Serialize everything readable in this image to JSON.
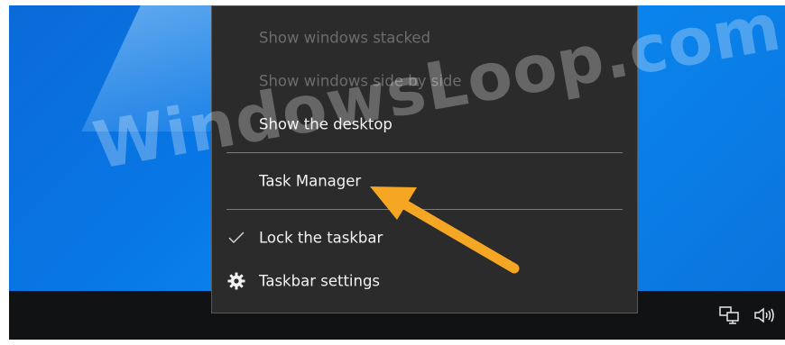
{
  "menu": {
    "items": [
      {
        "label": "Show windows stacked",
        "enabled": false
      },
      {
        "label": "Show windows side by side",
        "enabled": false
      },
      {
        "label": "Show the desktop",
        "enabled": true
      },
      {
        "label": "Task Manager",
        "enabled": true
      },
      {
        "label": "Lock the taskbar",
        "enabled": true,
        "checked": true
      },
      {
        "label": "Taskbar settings",
        "enabled": true,
        "icon": "gear-icon"
      }
    ]
  },
  "watermark": {
    "text": "WindowsLoop.com"
  },
  "annotation": {
    "arrow_color": "#f5a623",
    "points_to": "Task Manager"
  },
  "tray": {
    "icons": [
      "network-icon",
      "volume-icon"
    ]
  },
  "colors": {
    "menu_bg": "#2b2b2b",
    "taskbar_bg": "#111214",
    "desktop_blue": "#0878e6"
  }
}
